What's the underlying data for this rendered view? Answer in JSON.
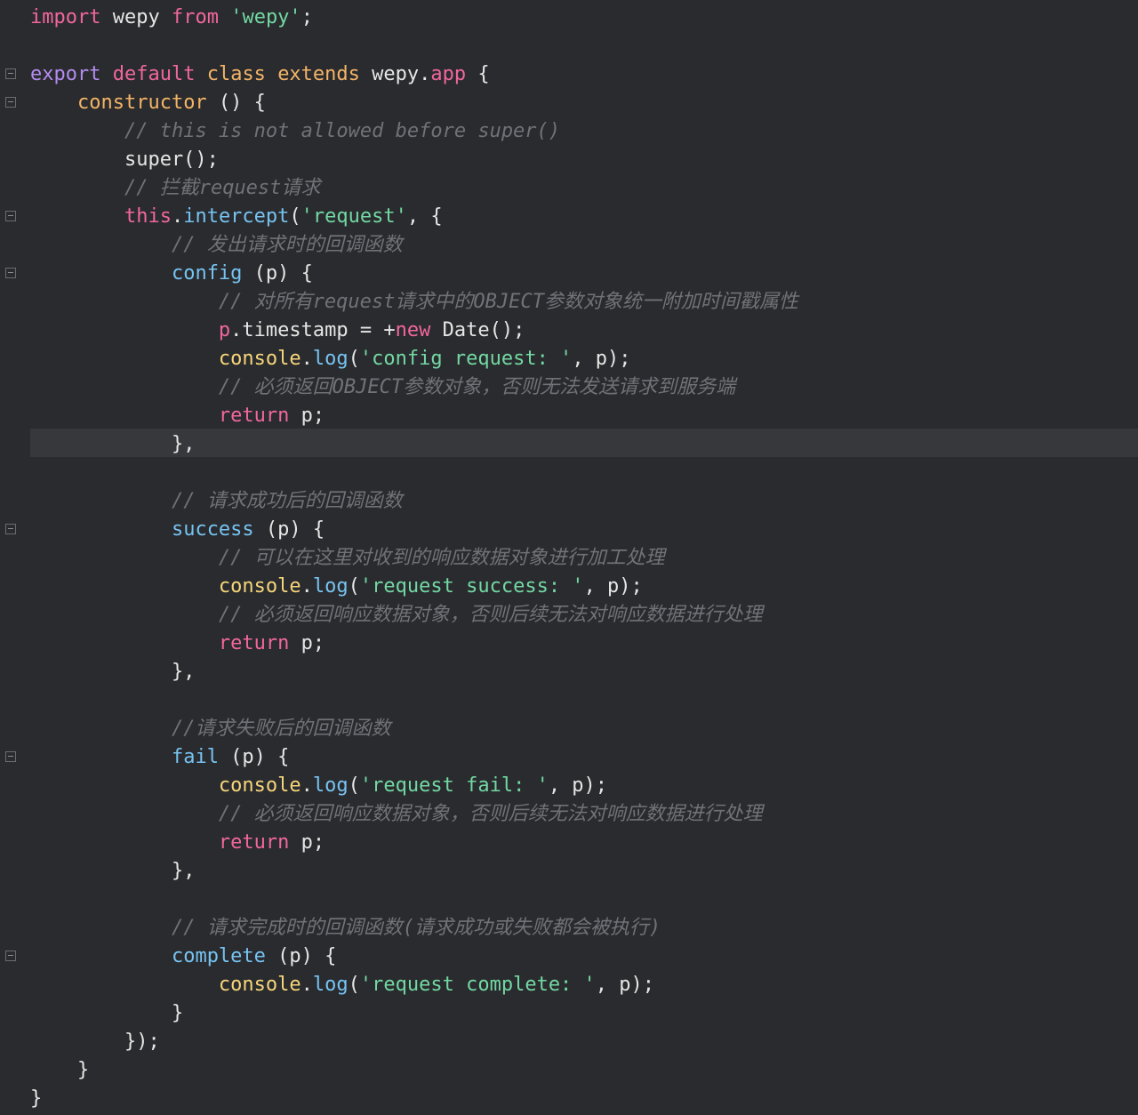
{
  "editor": {
    "lines": [
      {
        "tokens": [
          {
            "t": "import",
            "c": "kw"
          },
          {
            "t": " wepy ",
            "c": "txt"
          },
          {
            "t": "from",
            "c": "kw"
          },
          {
            "t": " ",
            "c": "txt"
          },
          {
            "t": "'wepy'",
            "c": "str"
          },
          {
            "t": ";",
            "c": "txt"
          }
        ],
        "fold": false
      },
      {
        "tokens": [],
        "fold": false
      },
      {
        "tokens": [
          {
            "t": "export",
            "c": "kwp"
          },
          {
            "t": " ",
            "c": "txt"
          },
          {
            "t": "default",
            "c": "kw"
          },
          {
            "t": " ",
            "c": "txt"
          },
          {
            "t": "class",
            "c": "fn"
          },
          {
            "t": " ",
            "c": "txt"
          },
          {
            "t": "extends",
            "c": "fn"
          },
          {
            "t": " wepy.",
            "c": "txt"
          },
          {
            "t": "app",
            "c": "kw"
          },
          {
            "t": " {",
            "c": "txt"
          }
        ],
        "fold": true
      },
      {
        "tokens": [
          {
            "t": "    ",
            "c": "txt"
          },
          {
            "t": "constructor",
            "c": "fn"
          },
          {
            "t": " () {",
            "c": "txt"
          }
        ],
        "fold": true
      },
      {
        "tokens": [
          {
            "t": "        ",
            "c": "txt"
          },
          {
            "t": "// this is not allowed before super()",
            "c": "cmt"
          }
        ],
        "fold": false
      },
      {
        "tokens": [
          {
            "t": "        super();",
            "c": "txt"
          }
        ],
        "fold": false
      },
      {
        "tokens": [
          {
            "t": "        ",
            "c": "txt"
          },
          {
            "t": "// 拦截request请求",
            "c": "cmt"
          }
        ],
        "fold": false
      },
      {
        "tokens": [
          {
            "t": "        ",
            "c": "txt"
          },
          {
            "t": "this",
            "c": "kw"
          },
          {
            "t": ".",
            "c": "txt"
          },
          {
            "t": "intercept",
            "c": "prop"
          },
          {
            "t": "(",
            "c": "txt"
          },
          {
            "t": "'request'",
            "c": "str"
          },
          {
            "t": ", {",
            "c": "txt"
          }
        ],
        "fold": true
      },
      {
        "tokens": [
          {
            "t": "            ",
            "c": "txt"
          },
          {
            "t": "// 发出请求时的回调函数",
            "c": "cmt"
          }
        ],
        "fold": false
      },
      {
        "tokens": [
          {
            "t": "            ",
            "c": "txt"
          },
          {
            "t": "config",
            "c": "prop"
          },
          {
            "t": " (p) {",
            "c": "txt"
          }
        ],
        "fold": true
      },
      {
        "tokens": [
          {
            "t": "                ",
            "c": "txt"
          },
          {
            "t": "// 对所有request请求中的OBJECT参数对象统一附加时间戳属性",
            "c": "cmt"
          }
        ],
        "fold": false
      },
      {
        "tokens": [
          {
            "t": "                ",
            "c": "txt"
          },
          {
            "t": "p",
            "c": "kw"
          },
          {
            "t": ".timestamp = +",
            "c": "txt"
          },
          {
            "t": "new",
            "c": "kw"
          },
          {
            "t": " Date();",
            "c": "txt"
          }
        ],
        "fold": false
      },
      {
        "tokens": [
          {
            "t": "                ",
            "c": "txt"
          },
          {
            "t": "console",
            "c": "obj"
          },
          {
            "t": ".",
            "c": "txt"
          },
          {
            "t": "log",
            "c": "prop"
          },
          {
            "t": "(",
            "c": "txt"
          },
          {
            "t": "'config request: '",
            "c": "str"
          },
          {
            "t": ", p);",
            "c": "txt"
          }
        ],
        "fold": false
      },
      {
        "tokens": [
          {
            "t": "                ",
            "c": "txt"
          },
          {
            "t": "// 必须返回OBJECT参数对象，否则无法发送请求到服务端",
            "c": "cmt"
          }
        ],
        "fold": false
      },
      {
        "tokens": [
          {
            "t": "                ",
            "c": "txt"
          },
          {
            "t": "return",
            "c": "kw"
          },
          {
            "t": " p;",
            "c": "txt"
          }
        ],
        "fold": false
      },
      {
        "tokens": [
          {
            "t": "            },",
            "c": "txt"
          }
        ],
        "fold": false,
        "current": true
      },
      {
        "tokens": [],
        "fold": false
      },
      {
        "tokens": [
          {
            "t": "            ",
            "c": "txt"
          },
          {
            "t": "// 请求成功后的回调函数",
            "c": "cmt"
          }
        ],
        "fold": false
      },
      {
        "tokens": [
          {
            "t": "            ",
            "c": "txt"
          },
          {
            "t": "success",
            "c": "prop"
          },
          {
            "t": " (p) {",
            "c": "txt"
          }
        ],
        "fold": true
      },
      {
        "tokens": [
          {
            "t": "                ",
            "c": "txt"
          },
          {
            "t": "// 可以在这里对收到的响应数据对象进行加工处理",
            "c": "cmt"
          }
        ],
        "fold": false
      },
      {
        "tokens": [
          {
            "t": "                ",
            "c": "txt"
          },
          {
            "t": "console",
            "c": "obj"
          },
          {
            "t": ".",
            "c": "txt"
          },
          {
            "t": "log",
            "c": "prop"
          },
          {
            "t": "(",
            "c": "txt"
          },
          {
            "t": "'request success: '",
            "c": "str"
          },
          {
            "t": ", p);",
            "c": "txt"
          }
        ],
        "fold": false
      },
      {
        "tokens": [
          {
            "t": "                ",
            "c": "txt"
          },
          {
            "t": "// 必须返回响应数据对象，否则后续无法对响应数据进行处理",
            "c": "cmt"
          }
        ],
        "fold": false
      },
      {
        "tokens": [
          {
            "t": "                ",
            "c": "txt"
          },
          {
            "t": "return",
            "c": "kw"
          },
          {
            "t": " p;",
            "c": "txt"
          }
        ],
        "fold": false
      },
      {
        "tokens": [
          {
            "t": "            },",
            "c": "txt"
          }
        ],
        "fold": false
      },
      {
        "tokens": [],
        "fold": false
      },
      {
        "tokens": [
          {
            "t": "            ",
            "c": "txt"
          },
          {
            "t": "//请求失败后的回调函数",
            "c": "cmt"
          }
        ],
        "fold": false
      },
      {
        "tokens": [
          {
            "t": "            ",
            "c": "txt"
          },
          {
            "t": "fail",
            "c": "prop"
          },
          {
            "t": " (p) {",
            "c": "txt"
          }
        ],
        "fold": true
      },
      {
        "tokens": [
          {
            "t": "                ",
            "c": "txt"
          },
          {
            "t": "console",
            "c": "obj"
          },
          {
            "t": ".",
            "c": "txt"
          },
          {
            "t": "log",
            "c": "prop"
          },
          {
            "t": "(",
            "c": "txt"
          },
          {
            "t": "'request fail: '",
            "c": "str"
          },
          {
            "t": ", p);",
            "c": "txt"
          }
        ],
        "fold": false
      },
      {
        "tokens": [
          {
            "t": "                ",
            "c": "txt"
          },
          {
            "t": "// 必须返回响应数据对象，否则后续无法对响应数据进行处理",
            "c": "cmt"
          }
        ],
        "fold": false
      },
      {
        "tokens": [
          {
            "t": "                ",
            "c": "txt"
          },
          {
            "t": "return",
            "c": "kw"
          },
          {
            "t": " p;",
            "c": "txt"
          }
        ],
        "fold": false
      },
      {
        "tokens": [
          {
            "t": "            },",
            "c": "txt"
          }
        ],
        "fold": false
      },
      {
        "tokens": [],
        "fold": false
      },
      {
        "tokens": [
          {
            "t": "            ",
            "c": "txt"
          },
          {
            "t": "// 请求完成时的回调函数(请求成功或失败都会被执行)",
            "c": "cmt"
          }
        ],
        "fold": false
      },
      {
        "tokens": [
          {
            "t": "            ",
            "c": "txt"
          },
          {
            "t": "complete",
            "c": "prop"
          },
          {
            "t": " (p) {",
            "c": "txt"
          }
        ],
        "fold": true
      },
      {
        "tokens": [
          {
            "t": "                ",
            "c": "txt"
          },
          {
            "t": "console",
            "c": "obj"
          },
          {
            "t": ".",
            "c": "txt"
          },
          {
            "t": "log",
            "c": "prop"
          },
          {
            "t": "(",
            "c": "txt"
          },
          {
            "t": "'request complete: '",
            "c": "str"
          },
          {
            "t": ", p);",
            "c": "txt"
          }
        ],
        "fold": false
      },
      {
        "tokens": [
          {
            "t": "            }",
            "c": "txt"
          }
        ],
        "fold": false
      },
      {
        "tokens": [
          {
            "t": "        });",
            "c": "txt"
          }
        ],
        "fold": false
      },
      {
        "tokens": [
          {
            "t": "    }",
            "c": "txt"
          }
        ],
        "fold": false
      },
      {
        "tokens": [
          {
            "t": "}",
            "c": "txt"
          }
        ],
        "fold": false
      }
    ]
  },
  "colors": {
    "background": "#2a2b2e",
    "current_line": "#36383c",
    "keyword": "#f0679d",
    "export_keyword": "#b48cf0",
    "function_name": "#f3b467",
    "string": "#72d8a3",
    "property": "#76c3f2",
    "console": "#f6d57a",
    "comment": "#6f7276",
    "text": "#e6e6e6"
  }
}
